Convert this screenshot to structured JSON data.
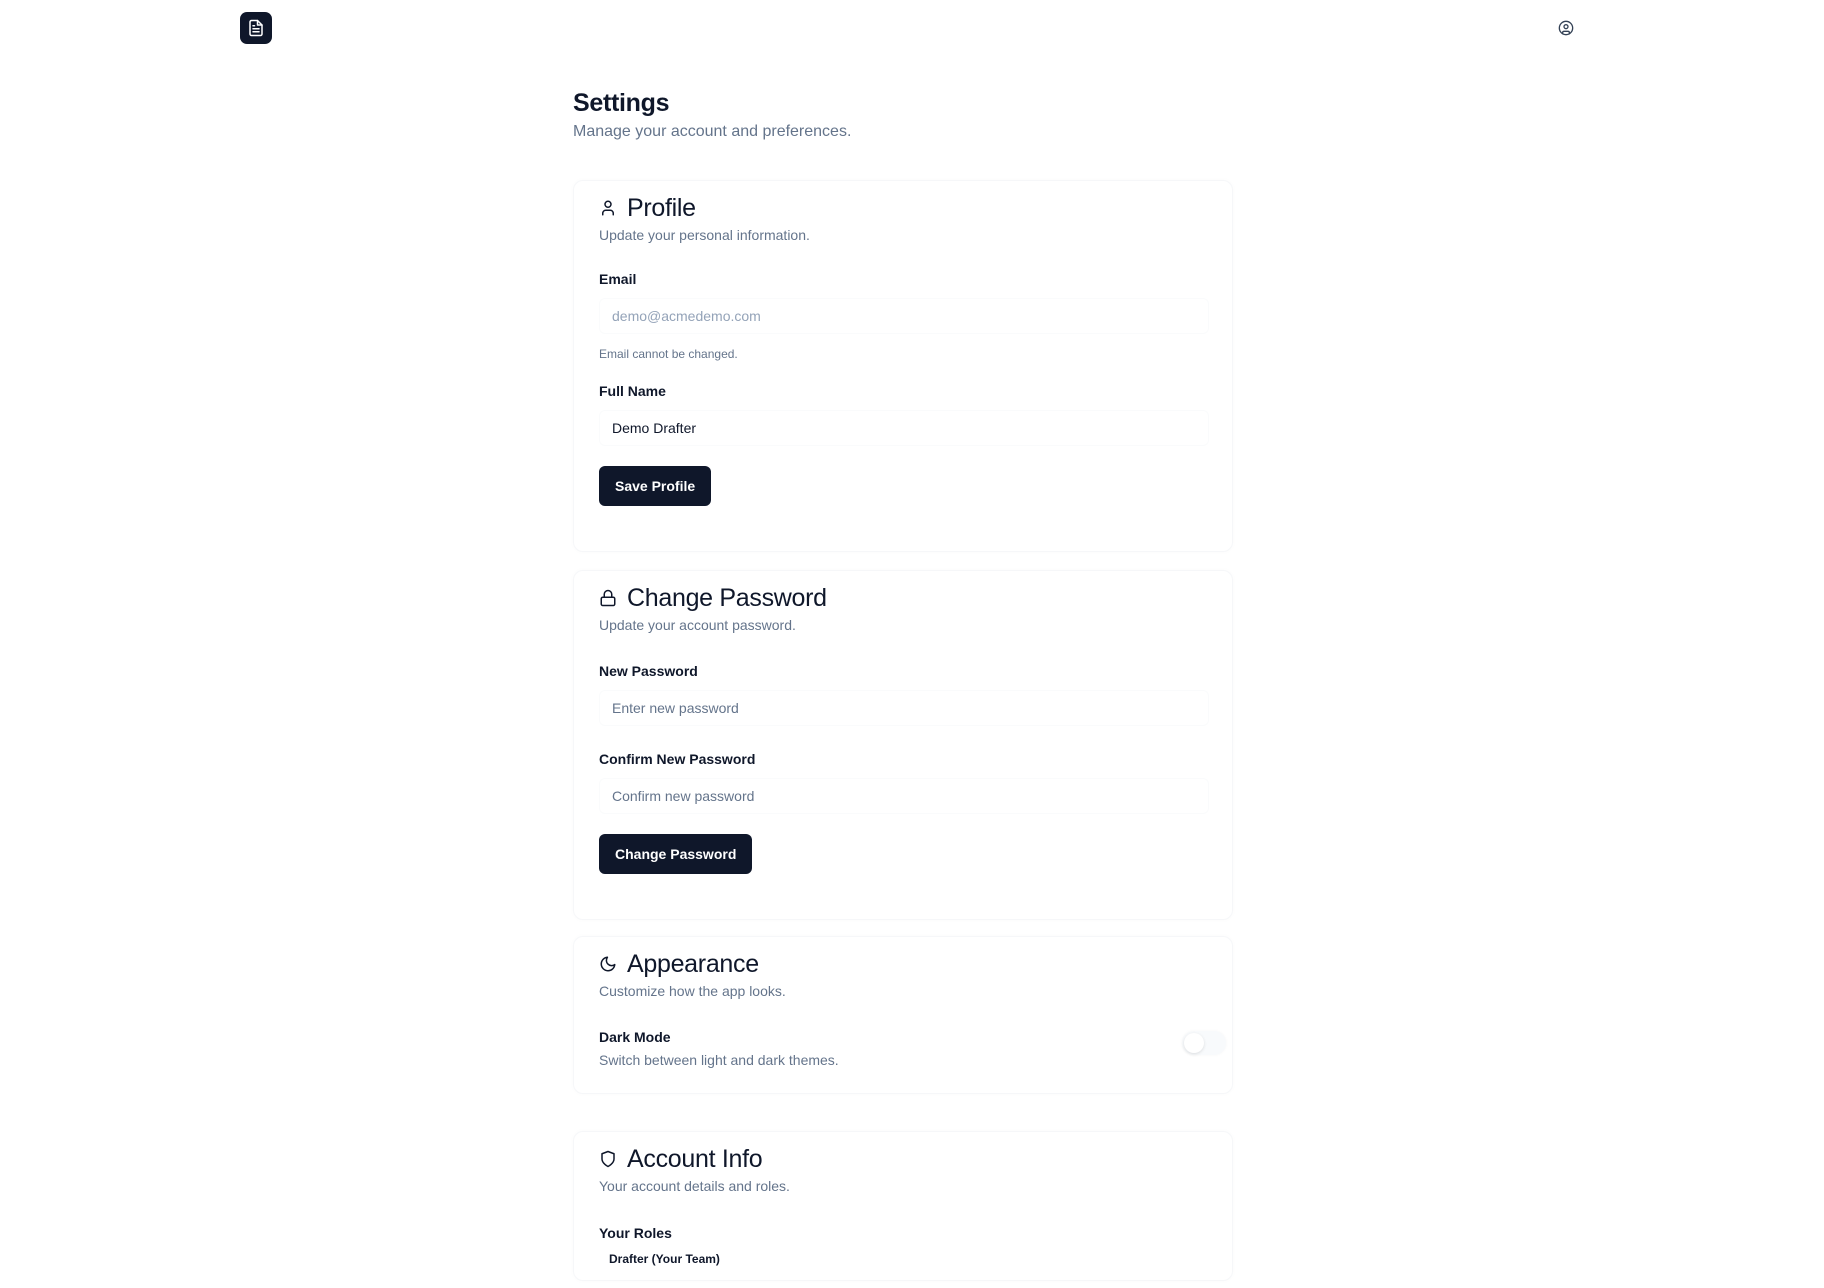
{
  "header": {
    "logo_icon": "file-text-icon",
    "user_icon": "user-circle-icon"
  },
  "page": {
    "title": "Settings",
    "subtitle": "Manage your account and preferences."
  },
  "profile": {
    "icon": "user-icon",
    "title": "Profile",
    "subtitle": "Update your personal information.",
    "email_label": "Email",
    "email_value": "demo@acmedemo.com",
    "email_hint": "Email cannot be changed.",
    "fullname_label": "Full Name",
    "fullname_value": "Demo Drafter",
    "save_label": "Save Profile"
  },
  "password": {
    "icon": "lock-icon",
    "title": "Change Password",
    "subtitle": "Update your account password.",
    "new_label": "New Password",
    "new_placeholder": "Enter new password",
    "confirm_label": "Confirm New Password",
    "confirm_placeholder": "Confirm new password",
    "button_label": "Change Password"
  },
  "appearance": {
    "icon": "moon-icon",
    "title": "Appearance",
    "subtitle": "Customize how the app looks.",
    "dark_mode_label": "Dark Mode",
    "dark_mode_desc": "Switch between light and dark themes.",
    "dark_mode_on": false
  },
  "account": {
    "icon": "shield-icon",
    "title": "Account Info",
    "subtitle": "Your account details and roles.",
    "roles_label": "Your Roles",
    "roles": [
      "Drafter (Your Team)"
    ]
  }
}
